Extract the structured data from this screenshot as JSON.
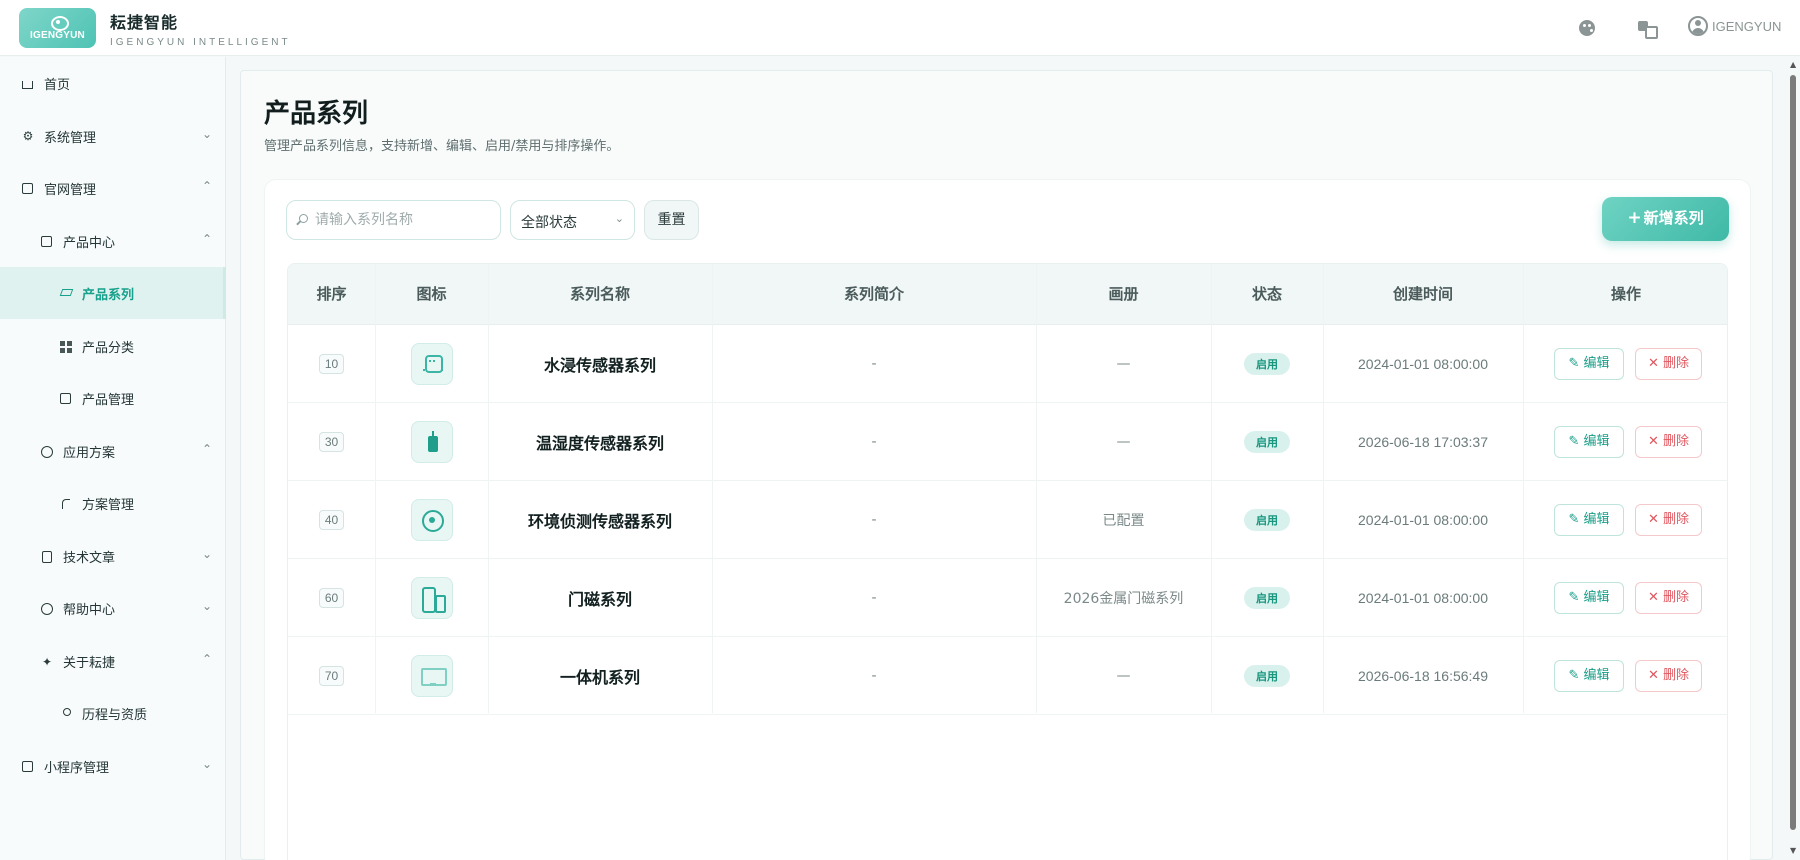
{
  "app": {
    "logo_text": "IGENGYUN",
    "brand_title": "耘捷智能",
    "brand_subtitle": "IGENGYUN INTELLIGENT",
    "username": "IGENGYUN"
  },
  "sidebar": {
    "items": [
      {
        "label": "首页",
        "icon": "home-icon",
        "chevron": ""
      },
      {
        "label": "系统管理",
        "icon": "settings-icon",
        "chevron": "⌄"
      },
      {
        "label": "官网管理",
        "icon": "cube-icon",
        "chevron": "⌃"
      },
      {
        "label": "产品中心",
        "icon": "cube-icon",
        "chevron": "⌃"
      },
      {
        "label": "产品系列",
        "icon": "layers-icon",
        "chevron": ""
      },
      {
        "label": "产品分类",
        "icon": "grid-icon",
        "chevron": ""
      },
      {
        "label": "产品管理",
        "icon": "cube-icon",
        "chevron": ""
      },
      {
        "label": "应用方案",
        "icon": "compass-icon",
        "chevron": "⌃"
      },
      {
        "label": "方案管理",
        "icon": "route-icon",
        "chevron": ""
      },
      {
        "label": "技术文章",
        "icon": "document-icon",
        "chevron": "⌄"
      },
      {
        "label": "帮助中心",
        "icon": "help-icon",
        "chevron": "⌄"
      },
      {
        "label": "关于耘捷",
        "icon": "sparkle-icon",
        "chevron": "⌃"
      },
      {
        "label": "历程与资质",
        "icon": "medal-icon",
        "chevron": ""
      },
      {
        "label": "小程序管理",
        "icon": "cube-icon",
        "chevron": "⌄"
      }
    ]
  },
  "page": {
    "title": "产品系列",
    "description": "管理产品系列信息，支持新增、编辑、启用/禁用与排序操作。"
  },
  "toolbar": {
    "search_placeholder": "请输入系列名称",
    "status_value": "全部状态",
    "reset_label": "重置",
    "add_label": "新增系列",
    "add_plus": "+"
  },
  "table": {
    "headers": [
      "排序",
      "图标",
      "系列名称",
      "系列简介",
      "画册",
      "状态",
      "创建时间",
      "操作"
    ],
    "rows": [
      {
        "sort": "10",
        "icon": "water-sensor-icon",
        "name": "水浸传感器系列",
        "intro": "-",
        "album": "—",
        "status": "启用",
        "created": "2024-01-01 08:00:00"
      },
      {
        "sort": "30",
        "icon": "temp-humidity-sensor-icon",
        "name": "温湿度传感器系列",
        "intro": "-",
        "album": "—",
        "status": "启用",
        "created": "2026-06-18 17:03:37"
      },
      {
        "sort": "40",
        "icon": "environment-sensor-icon",
        "name": "环境侦测传感器系列",
        "intro": "-",
        "album": "已配置",
        "status": "启用",
        "created": "2024-01-01 08:00:00"
      },
      {
        "sort": "60",
        "icon": "door-sensor-icon",
        "name": "门磁系列",
        "intro": "-",
        "album": "2026金属门磁系列",
        "status": "启用",
        "created": "2024-01-01 08:00:00"
      },
      {
        "sort": "70",
        "icon": "all-in-one-screen-icon",
        "name": "一体机系列",
        "intro": "-",
        "album": "—",
        "status": "启用",
        "created": "2026-06-18 16:56:49"
      }
    ],
    "edit_label": "编辑",
    "delete_label": "删除",
    "edit_glyph": "✎",
    "delete_glyph": "✕"
  },
  "colors": {
    "accent": "#3fb9a7",
    "danger": "#e0575f",
    "active_bg": "#dff2ef"
  }
}
